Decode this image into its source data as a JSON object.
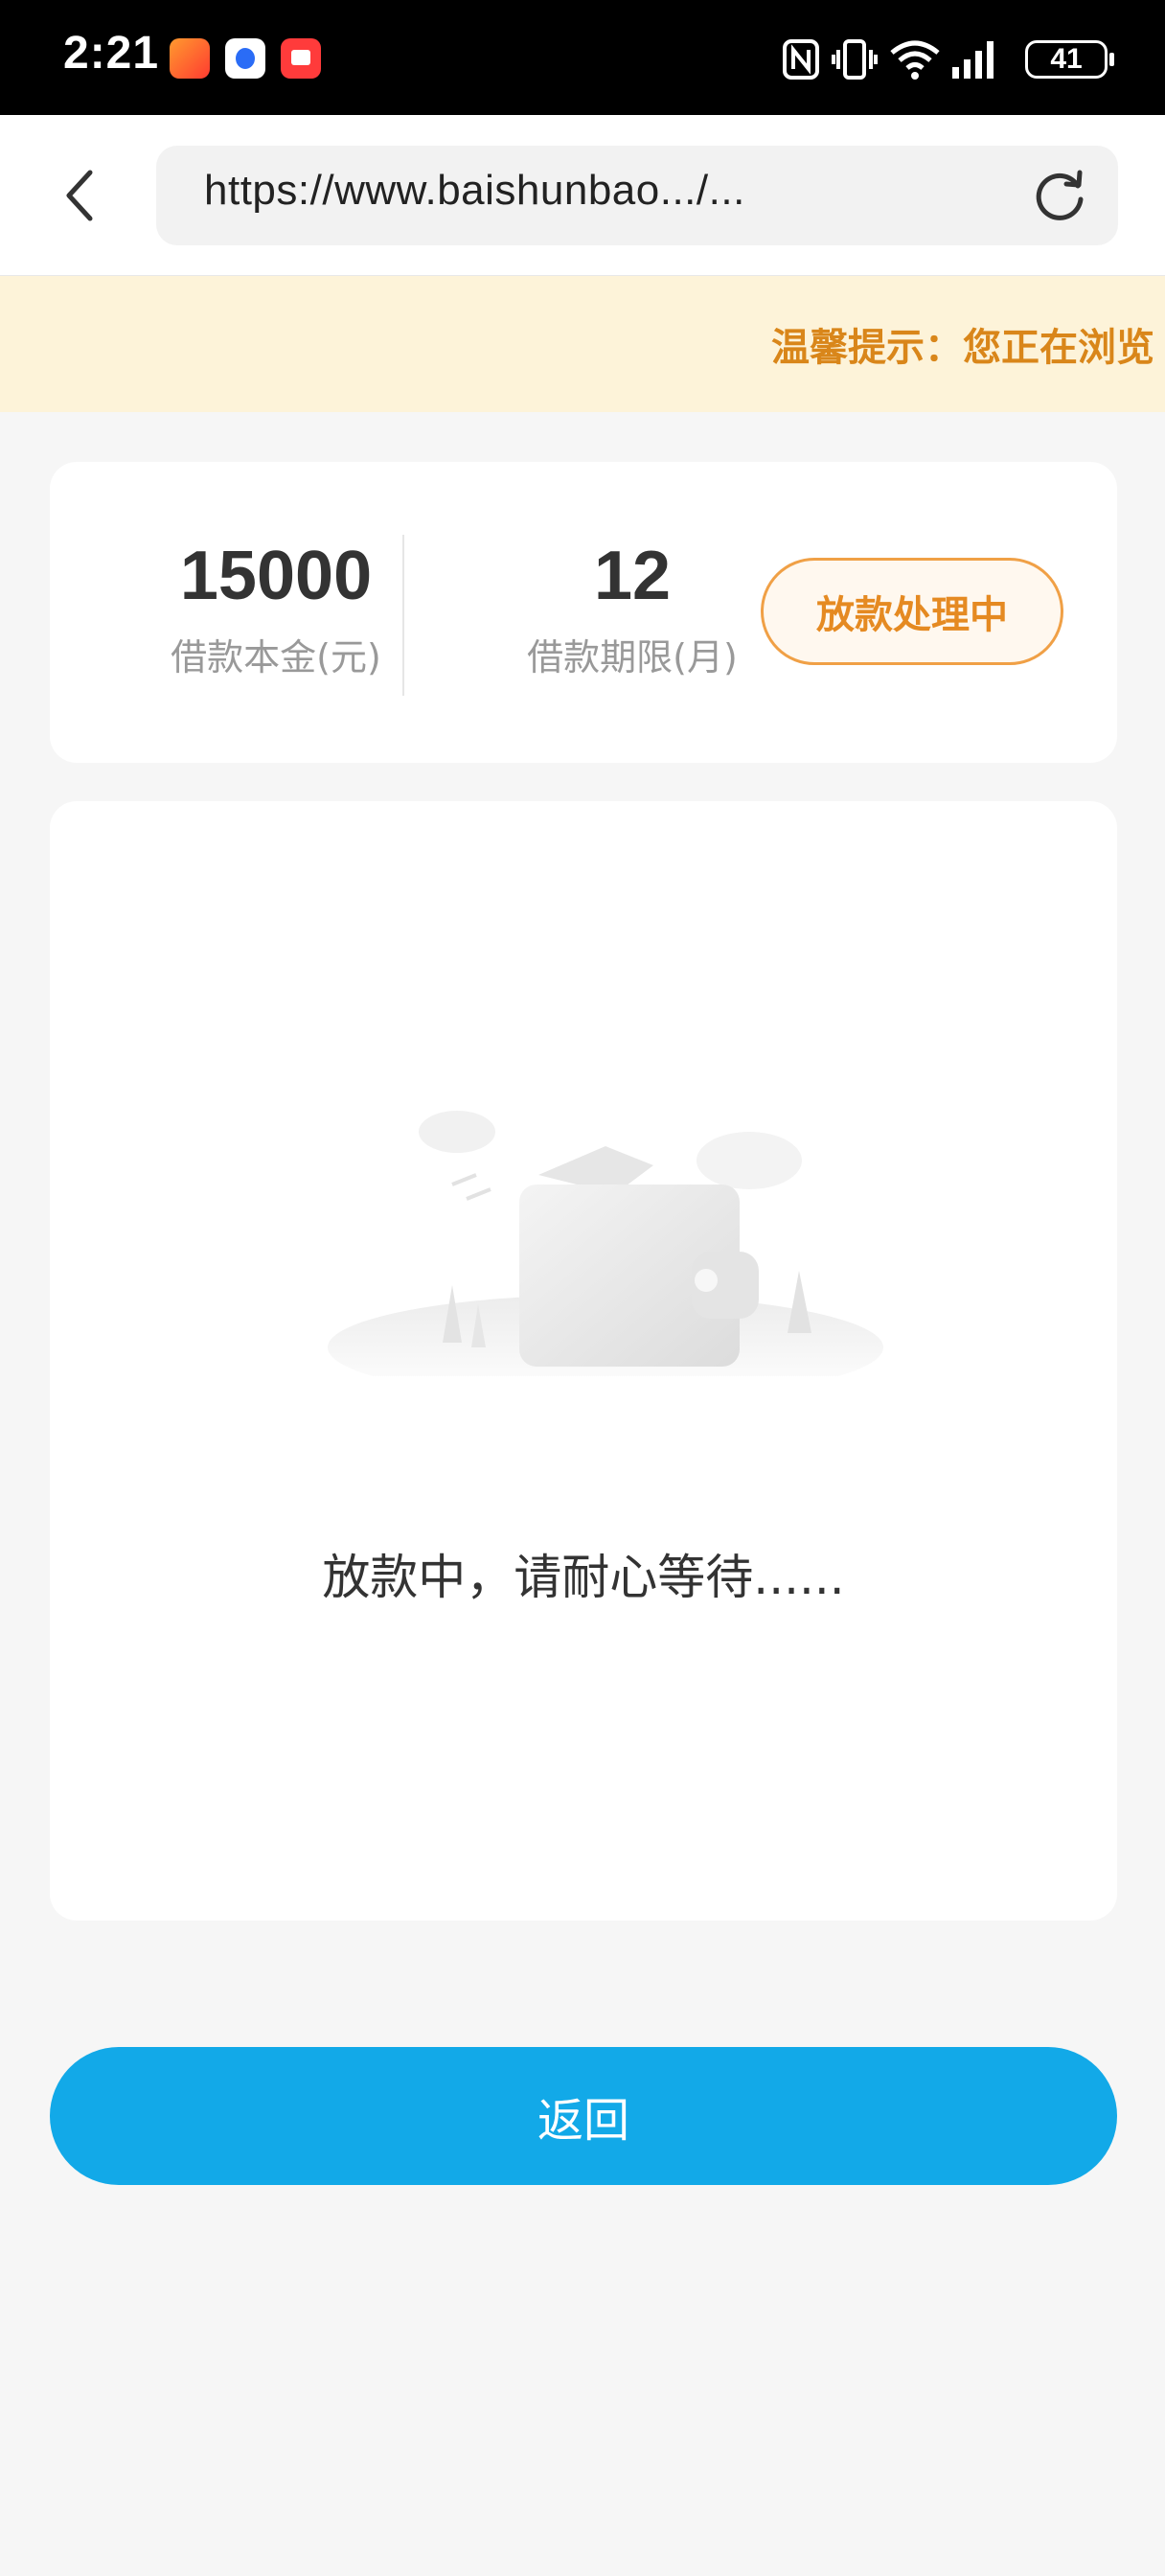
{
  "status_bar": {
    "time": "2:21",
    "app_icons": [
      "app-icon-1",
      "baidu-icon",
      "reader-icon"
    ],
    "battery": "41",
    "indicators": [
      "nfc-icon",
      "vibrate-icon",
      "wifi-icon",
      "signal-icon"
    ]
  },
  "browser": {
    "url": "https://www.baishunbao.../..."
  },
  "notice": {
    "text": "温馨提示：您正在浏览"
  },
  "loan": {
    "principal_value": "15000",
    "principal_label": "借款本金(元)",
    "term_value": "12",
    "term_label": "借款期限(月)",
    "status": "放款处理中"
  },
  "main": {
    "message": "放款中，请耐心等待......"
  },
  "actions": {
    "return_label": "返回"
  },
  "colors": {
    "accent_blue": "#12a9e8",
    "status_orange": "#e58a22",
    "notice_bg": "#fdf3d9"
  }
}
